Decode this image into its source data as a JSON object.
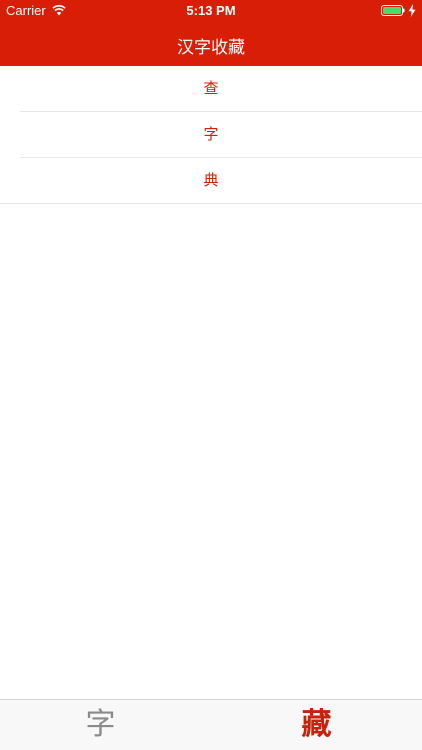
{
  "status_bar": {
    "carrier": "Carrier",
    "time": "5:13 PM"
  },
  "nav": {
    "title": "汉字收藏"
  },
  "list": {
    "items": [
      {
        "label": "查"
      },
      {
        "label": "字"
      },
      {
        "label": "典"
      }
    ]
  },
  "tab_bar": {
    "tabs": [
      {
        "label": "字",
        "icon": "character-icon",
        "selected": false
      },
      {
        "label": "藏",
        "icon": "collection-icon",
        "selected": true
      }
    ]
  },
  "colors": {
    "header_bg": "#d81e06",
    "item_text": "#cc2200",
    "tab_selected": "#c8200c",
    "tab_unselected": "#8a8a8a"
  }
}
